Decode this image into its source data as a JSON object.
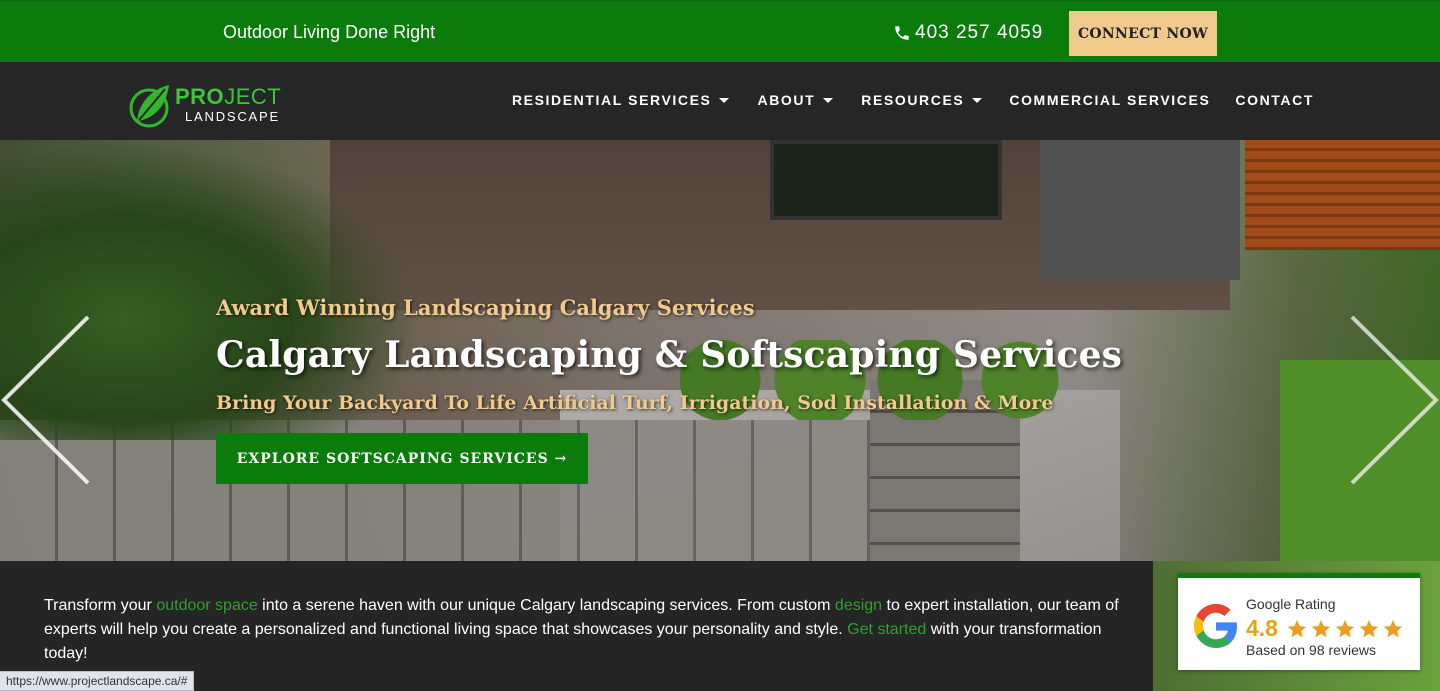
{
  "topbar": {
    "tagline": "Outdoor Living Done Right",
    "phone": "403 257 4059",
    "cta": "CONNECT NOW"
  },
  "logo": {
    "pro": "PRO",
    "ject": "JECT",
    "landscape": "LANDSCAPE"
  },
  "nav": {
    "items": [
      {
        "label": "RESIDENTIAL SERVICES",
        "dropdown": true
      },
      {
        "label": "ABOUT",
        "dropdown": true
      },
      {
        "label": "RESOURCES",
        "dropdown": true
      },
      {
        "label": "COMMERCIAL SERVICES",
        "dropdown": false
      },
      {
        "label": "CONTACT",
        "dropdown": false
      }
    ]
  },
  "hero": {
    "kicker": "Award Winning Landscaping Calgary Services",
    "title": "Calgary Landscaping & Softscaping Services",
    "subtitle": "Bring Your Backyard To Life Artificial Turf, Irrigation, Sod Installation & More",
    "cta": "EXPLORE SOFTSCAPING SERVICES →"
  },
  "intro": {
    "p1": "Transform your ",
    "link1": "outdoor space",
    "p2": " into a serene haven with our unique Calgary landscaping services. From custom ",
    "link2": "design",
    "p3": " to expert installation, our team of experts will help you create a personalized and functional living space that showcases your personality and style. ",
    "link3": "Get started",
    "p4": " with your transformation today!"
  },
  "google": {
    "label": "Google Rating",
    "score": "4.8",
    "stars": 5,
    "reviews": "Based on 98 reviews"
  },
  "status": {
    "url": "https://www.projectlandscape.ca/#"
  },
  "colors": {
    "brand_green": "#0b7c0b",
    "accent_gold": "#f0c98c",
    "dark": "#262626",
    "link_green": "#2fa12f",
    "star": "#e7a11f"
  },
  "icons": {
    "phone": "phone-icon",
    "logo": "leaf-logo-icon",
    "prev": "chevron-left-icon",
    "next": "chevron-right-icon",
    "google": "google-g-icon",
    "star": "star-icon"
  }
}
